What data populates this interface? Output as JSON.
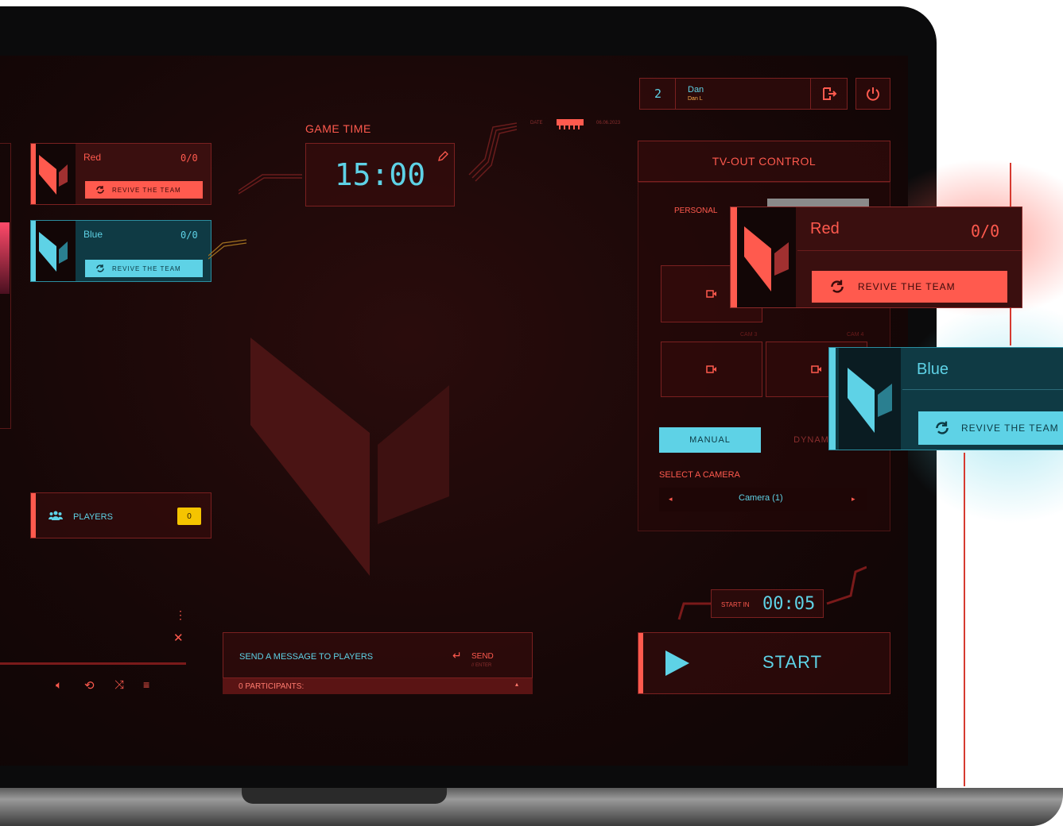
{
  "game_time": {
    "label": "GAME TIME",
    "value": "15:00"
  },
  "date": {
    "label": "DATE",
    "value": "06.06.2023"
  },
  "user": {
    "count": "2",
    "name": "Dan",
    "sub": "Dan L"
  },
  "teams": [
    {
      "name": "Red",
      "score": "0/0",
      "revive": "REVIVE THE TEAM",
      "color": "#ff5a4e"
    },
    {
      "name": "Blue",
      "score": "0/0",
      "revive": "REVIVE THE TEAM",
      "color": "#5ed2e6"
    }
  ],
  "players": {
    "label": "PLAYERS",
    "count": "0"
  },
  "tv_out": {
    "title": "TV-OUT CONTROL",
    "personal_label": "PERSONAL",
    "cam_labels": [
      "CAM 3",
      "CAM 4"
    ],
    "modes": [
      "MANUAL",
      "DYNAMIC"
    ],
    "select_label": "SELECT A CAMERA",
    "camera_value": "Camera (1)"
  },
  "start": {
    "countdown_label": "START IN",
    "countdown_value": "00:05",
    "button_label": "START"
  },
  "message": {
    "label": "SEND A MESSAGE TO PLAYERS",
    "send_label": "SEND",
    "send_hint": "// ENTER",
    "participants": "0 PARTICIPANTS:"
  },
  "popups": {
    "red": {
      "name": "Red",
      "score": "0/0",
      "revive": "REVIVE THE TEAM"
    },
    "blue": {
      "name": "Blue",
      "revive": "REVIVE THE TEAM"
    }
  },
  "colors": {
    "accent_red": "#ff5a4e",
    "accent_cyan": "#5ed2e6",
    "badge_yellow": "#f5c400",
    "bg": "#1a0909"
  },
  "icons": [
    "edit-icon",
    "logout-icon",
    "power-icon",
    "refresh-icon",
    "camera-icon",
    "play-icon",
    "players-icon",
    "volume-icon",
    "repeat-icon",
    "shuffle-icon",
    "queue-icon",
    "more-icon",
    "close-icon",
    "enter-icon"
  ]
}
